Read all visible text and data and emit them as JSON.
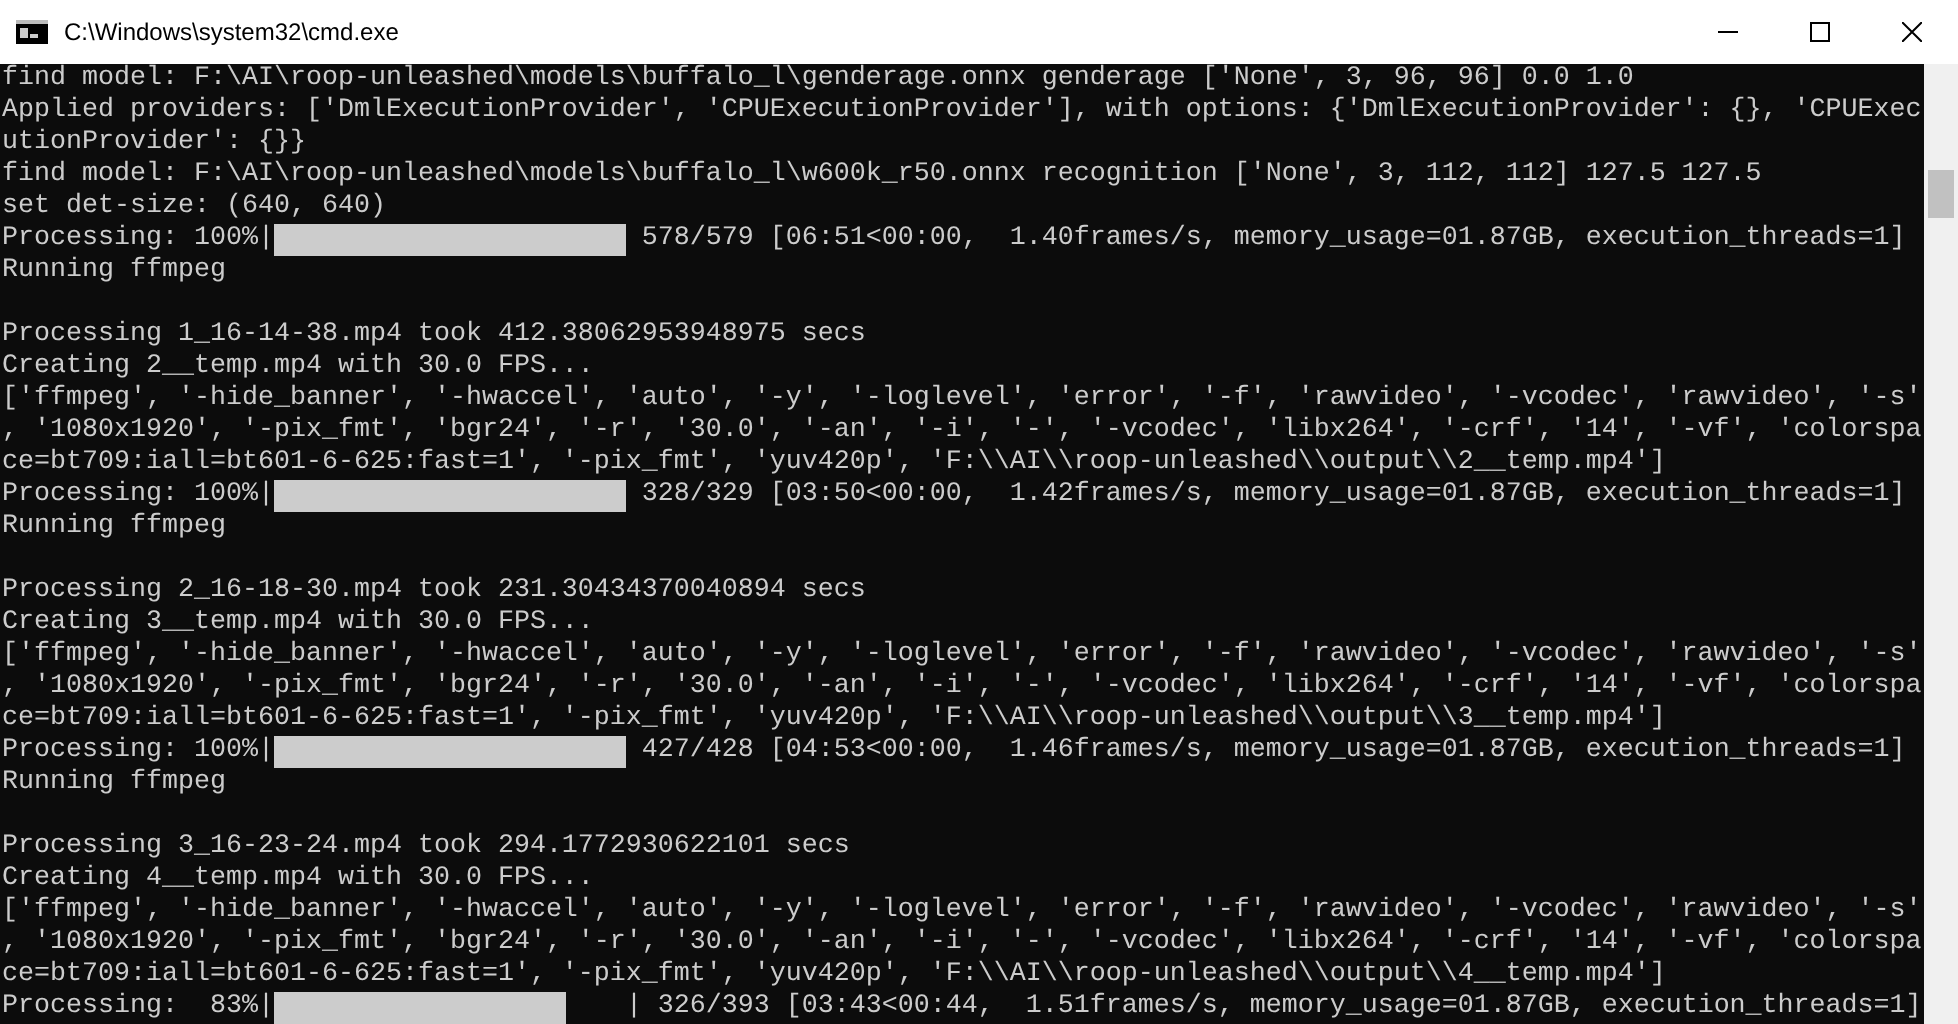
{
  "window": {
    "title": "C:\\Windows\\system32\\cmd.exe"
  },
  "console": {
    "lines": [
      {
        "kind": "text",
        "text": "find model: F:\\AI\\roop-unleashed\\models\\buffalo_l\\genderage.onnx genderage ['None', 3, 96, 96] 0.0 1.0"
      },
      {
        "kind": "text",
        "text": "Applied providers: ['DmlExecutionProvider', 'CPUExecutionProvider'], with options: {'DmlExecutionProvider': {}, 'CPUExec"
      },
      {
        "kind": "text",
        "text": "utionProvider': {}}"
      },
      {
        "kind": "text",
        "text": "find model: F:\\AI\\roop-unleashed\\models\\buffalo_l\\w600k_r50.onnx recognition ['None', 3, 112, 112] 127.5 127.5"
      },
      {
        "kind": "text",
        "text": "set det-size: (640, 640)"
      },
      {
        "kind": "progress",
        "prefix": "Processing: 100%|",
        "level": 1.0,
        "suffix": " 578/579 [06:51<00:00,  1.40frames/s, memory_usage=01.87GB, execution_threads=1]"
      },
      {
        "kind": "text",
        "text": "Running ffmpeg"
      },
      {
        "kind": "blank"
      },
      {
        "kind": "text",
        "text": "Processing 1_16-14-38.mp4 took 412.38062953948975 secs"
      },
      {
        "kind": "text",
        "text": "Creating 2__temp.mp4 with 30.0 FPS..."
      },
      {
        "kind": "text",
        "text": "['ffmpeg', '-hide_banner', '-hwaccel', 'auto', '-y', '-loglevel', 'error', '-f', 'rawvideo', '-vcodec', 'rawvideo', '-s'"
      },
      {
        "kind": "text",
        "text": ", '1080x1920', '-pix_fmt', 'bgr24', '-r', '30.0', '-an', '-i', '-', '-vcodec', 'libx264', '-crf', '14', '-vf', 'colorspa"
      },
      {
        "kind": "text",
        "text": "ce=bt709:iall=bt601-6-625:fast=1', '-pix_fmt', 'yuv420p', 'F:\\\\AI\\\\roop-unleashed\\\\output\\\\2__temp.mp4']"
      },
      {
        "kind": "progress",
        "prefix": "Processing: 100%|",
        "level": 1.0,
        "suffix": " 328/329 [03:50<00:00,  1.42frames/s, memory_usage=01.87GB, execution_threads=1]"
      },
      {
        "kind": "text",
        "text": "Running ffmpeg"
      },
      {
        "kind": "blank"
      },
      {
        "kind": "text",
        "text": "Processing 2_16-18-30.mp4 took 231.30434370040894 secs"
      },
      {
        "kind": "text",
        "text": "Creating 3__temp.mp4 with 30.0 FPS..."
      },
      {
        "kind": "text",
        "text": "['ffmpeg', '-hide_banner', '-hwaccel', 'auto', '-y', '-loglevel', 'error', '-f', 'rawvideo', '-vcodec', 'rawvideo', '-s'"
      },
      {
        "kind": "text",
        "text": ", '1080x1920', '-pix_fmt', 'bgr24', '-r', '30.0', '-an', '-i', '-', '-vcodec', 'libx264', '-crf', '14', '-vf', 'colorspa"
      },
      {
        "kind": "text",
        "text": "ce=bt709:iall=bt601-6-625:fast=1', '-pix_fmt', 'yuv420p', 'F:\\\\AI\\\\roop-unleashed\\\\output\\\\3__temp.mp4']"
      },
      {
        "kind": "progress",
        "prefix": "Processing: 100%|",
        "level": 1.0,
        "suffix": " 427/428 [04:53<00:00,  1.46frames/s, memory_usage=01.87GB, execution_threads=1]"
      },
      {
        "kind": "text",
        "text": "Running ffmpeg"
      },
      {
        "kind": "blank"
      },
      {
        "kind": "text",
        "text": "Processing 3_16-23-24.mp4 took 294.1772930622101 secs"
      },
      {
        "kind": "text",
        "text": "Creating 4__temp.mp4 with 30.0 FPS..."
      },
      {
        "kind": "text",
        "text": "['ffmpeg', '-hide_banner', '-hwaccel', 'auto', '-y', '-loglevel', 'error', '-f', 'rawvideo', '-vcodec', 'rawvideo', '-s'"
      },
      {
        "kind": "text",
        "text": ", '1080x1920', '-pix_fmt', 'bgr24', '-r', '30.0', '-an', '-i', '-', '-vcodec', 'libx264', '-crf', '14', '-vf', 'colorspa"
      },
      {
        "kind": "text",
        "text": "ce=bt709:iall=bt601-6-625:fast=1', '-pix_fmt', 'yuv420p', 'F:\\\\AI\\\\roop-unleashed\\\\output\\\\4__temp.mp4']"
      },
      {
        "kind": "progress",
        "prefix": "Processing:  83%|",
        "level": 0.83,
        "suffix": "| 326/393 [03:43<00:44,  1.51frames/s, memory_usage=01.87GB, execution_threads=1]"
      }
    ]
  }
}
